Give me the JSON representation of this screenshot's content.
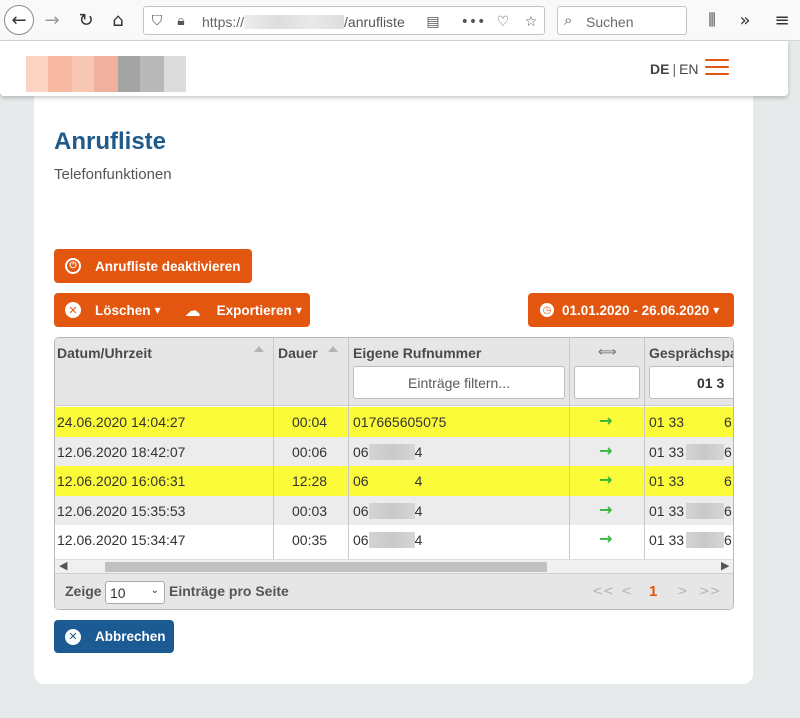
{
  "browser": {
    "url_prefix": "https://",
    "url_path": "/anrufliste",
    "search_placeholder": "Suchen"
  },
  "header": {
    "lang_active": "DE",
    "lang_separator": "|",
    "lang_other": "EN",
    "accent_color": "#e2560f"
  },
  "page": {
    "title": "Anrufliste",
    "subtitle": "Telefonfunktionen"
  },
  "actions": {
    "deactivate": "Anrufliste deaktivieren",
    "delete": "Löschen",
    "export": "Exportieren",
    "date_range": "01.01.2020 - 26.06.2020",
    "cancel": "Abbrechen"
  },
  "table": {
    "columns": {
      "datetime": "Datum/Uhrzeit",
      "duration": "Dauer",
      "own_number": "Eigene Rufnummer",
      "direction_icon": "⟺",
      "partner": "Gesprächspa"
    },
    "filter_placeholder": "Einträge filtern...",
    "partner_filter_value": "01 3",
    "rows": [
      {
        "datetime": "24.06.2020 14:04:27",
        "duration": "00:04",
        "own_number": "017665605075",
        "own_suffix": "",
        "direction": "→",
        "partner": "01   33",
        "partner_end": "6",
        "highlight": true
      },
      {
        "datetime": "12.06.2020 18:42:07",
        "duration": "00:06",
        "own_number": "06",
        "own_suffix": "4",
        "direction": "→",
        "partner": "01 33",
        "partner_end": "6",
        "highlight": false
      },
      {
        "datetime": "12.06.2020 16:06:31",
        "duration": "12:28",
        "own_number": "06",
        "own_suffix": "4",
        "direction": "→",
        "partner": "01   33",
        "partner_end": "6",
        "highlight": true
      },
      {
        "datetime": "12.06.2020 15:35:53",
        "duration": "00:03",
        "own_number": "06",
        "own_suffix": "4",
        "direction": "→",
        "partner": "01   33",
        "partner_end": "6",
        "highlight": false
      },
      {
        "datetime": "12.06.2020 15:34:47",
        "duration": "00:35",
        "own_number": "06",
        "own_suffix": "4",
        "direction": "→",
        "partner": "01 33",
        "partner_end": "6",
        "highlight": false
      }
    ]
  },
  "footer": {
    "show_label": "Zeige",
    "page_size": "10",
    "per_page_label": "Einträge pro Seite",
    "first": "<<",
    "prev": "<",
    "current_page": "1",
    "next": ">",
    "last": ">>"
  }
}
